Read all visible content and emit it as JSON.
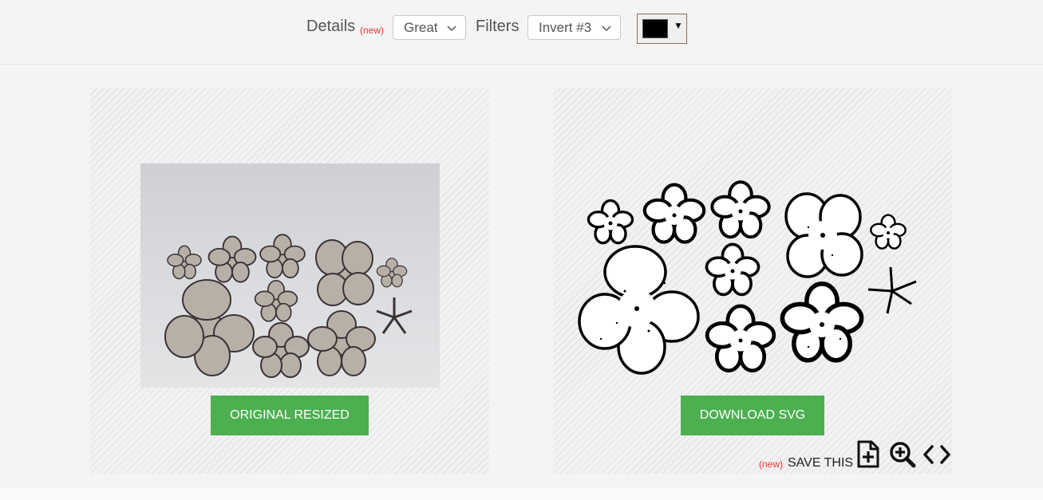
{
  "toolbar": {
    "details_label": "Details",
    "details_new": "(new)",
    "details_value": "Great",
    "filters_label": "Filters",
    "filters_value": "Invert #3",
    "color_value": "#000000"
  },
  "left_panel": {
    "button_label": "ORIGINAL RESIZED"
  },
  "right_panel": {
    "button_label": "DOWNLOAD SVG",
    "save_new": "(new)",
    "save_label": "SAVE THIS",
    "icons": [
      "add-file-icon",
      "zoom-in-icon",
      "code-icon"
    ]
  },
  "colors": {
    "accent_button": "#4caf50",
    "new_badge": "#e53935"
  }
}
